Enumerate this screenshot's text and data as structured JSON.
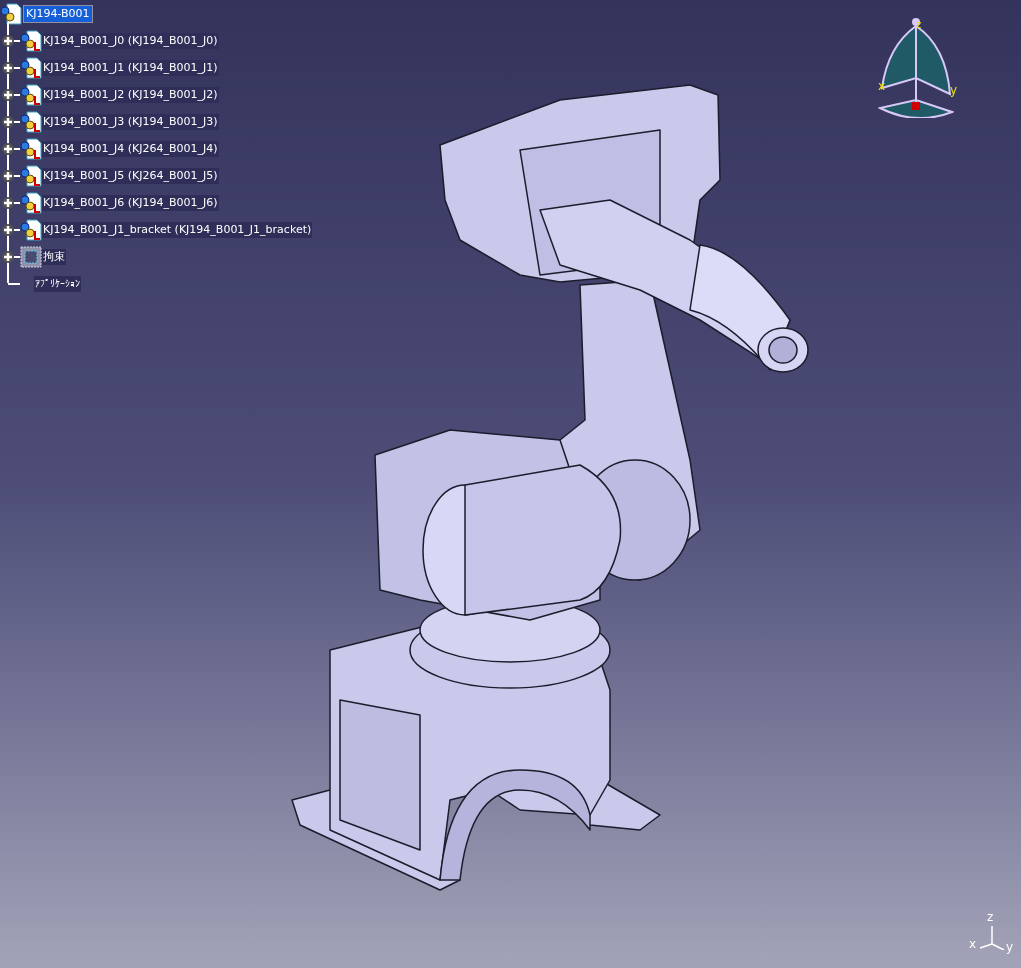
{
  "tree": {
    "root": {
      "label": "KJ194-B001",
      "selected": true
    },
    "children": [
      {
        "kind": "part",
        "label": "KJ194_B001_J0 (KJ194_B001_J0)",
        "selected": false
      },
      {
        "kind": "part",
        "label": "KJ194_B001_J1 (KJ194_B001_J1)",
        "selected": false
      },
      {
        "kind": "part",
        "label": "KJ194_B001_J2 (KJ194_B001_J2)",
        "selected": false
      },
      {
        "kind": "part",
        "label": "KJ194_B001_J3 (KJ194_B001_J3)",
        "selected": false
      },
      {
        "kind": "part",
        "label": "KJ194_B001_J4 (KJ264_B001_J4)",
        "selected": false
      },
      {
        "kind": "part",
        "label": "KJ194_B001_J5 (KJ264_B001_J5)",
        "selected": false
      },
      {
        "kind": "part",
        "label": "KJ194_B001_J6 (KJ194_B001_J6)",
        "selected": false
      },
      {
        "kind": "part",
        "label": "KJ194_B001_J1_bracket (KJ194_B001_J1_bracket)",
        "selected": false
      },
      {
        "kind": "constraints",
        "label": "拘束",
        "selected": false
      },
      {
        "kind": "applications",
        "label": "ｱﾌﾟﾘｹｰｼｮﾝ",
        "selected": false
      }
    ]
  },
  "compass": {
    "x": "x",
    "y": "y",
    "z": "z"
  },
  "axis_triad": {
    "x": "x",
    "y": "y",
    "z": "z"
  }
}
